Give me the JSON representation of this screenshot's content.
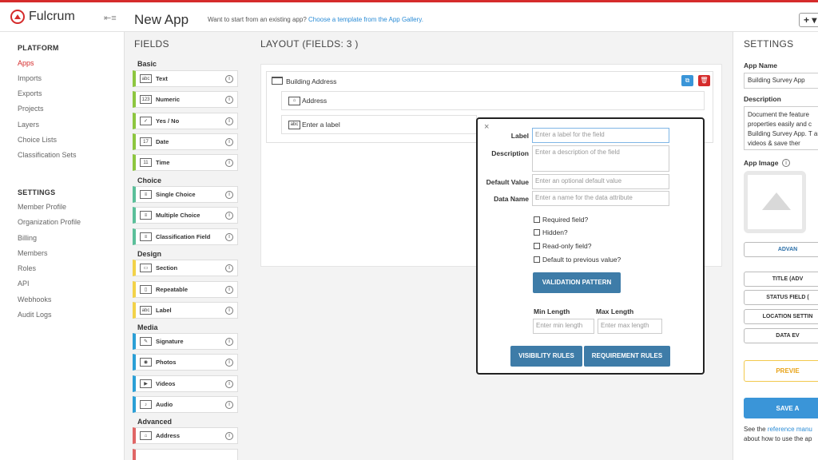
{
  "header": {
    "brand": "Fulcrum",
    "title": "New App",
    "gallery_prompt": "Want to start from an existing app?",
    "gallery_link": "Choose a template from the App Gallery.",
    "plus_label": "+ ▾"
  },
  "sidebar": {
    "platform_heading": "PLATFORM",
    "platform_items": [
      "Apps",
      "Imports",
      "Exports",
      "Projects",
      "Layers",
      "Choice Lists",
      "Classification Sets"
    ],
    "settings_heading": "SETTINGS",
    "settings_items": [
      "Member Profile",
      "Organization Profile",
      "Billing",
      "Members",
      "Roles",
      "API",
      "Webhooks",
      "Audit Logs"
    ]
  },
  "fields": {
    "title": "FIELDS",
    "categories": [
      "Basic",
      "Choice",
      "Design",
      "Media",
      "Advanced"
    ],
    "items": [
      {
        "label": "Text",
        "icon": "abc"
      },
      {
        "label": "Numeric",
        "icon": "123"
      },
      {
        "label": "Yes / No",
        "icon": "✓"
      },
      {
        "label": "Date",
        "icon": "17"
      },
      {
        "label": "Time",
        "icon": "11"
      },
      {
        "label": "Single Choice",
        "icon": "≡"
      },
      {
        "label": "Multiple Choice",
        "icon": "≡"
      },
      {
        "label": "Classification Field",
        "icon": "≡"
      },
      {
        "label": "Section",
        "icon": "▭"
      },
      {
        "label": "Repeatable",
        "icon": "▯"
      },
      {
        "label": "Label",
        "icon": "abc"
      },
      {
        "label": "Signature",
        "icon": "✎"
      },
      {
        "label": "Photos",
        "icon": "◉"
      },
      {
        "label": "Videos",
        "icon": "▶"
      },
      {
        "label": "Audio",
        "icon": "♪"
      },
      {
        "label": "Address",
        "icon": "⌂"
      }
    ],
    "colors": {
      "basic": "#8dc63f",
      "choice": "#5bbf9a",
      "design": "#f2d249",
      "media": "#2b9fd6",
      "advanced": "#e06666"
    }
  },
  "layout": {
    "title": "LAYOUT  (FIELDS: 3 )",
    "section_label": "Building Address",
    "sub_fields": [
      "Address",
      "Enter a label"
    ]
  },
  "popup": {
    "close": "×",
    "label_label": "Label",
    "label_placeholder": "Enter a label for the field",
    "description_label": "Description",
    "description_placeholder": "Enter a description of the field",
    "default_label": "Default Value",
    "default_placeholder": "Enter an optional default value",
    "dataname_label": "Data Name",
    "dataname_placeholder": "Enter a name for the data attribute",
    "checkboxes": [
      "Required field?",
      "Hidden?",
      "Read-only field?",
      "Default to previous value?"
    ],
    "validation_button": "VALIDATION PATTERN",
    "min_label": "Min Length",
    "max_label": "Max Length",
    "min_placeholder": "Enter min length",
    "max_placeholder": "Enter max length",
    "visibility_button": "VISIBILITY RULES",
    "requirement_button": "REQUIREMENT RULES"
  },
  "settings": {
    "title": "SETTINGS",
    "app_name_label": "App Name",
    "app_name_value": "Building Survey App",
    "description_label": "Description",
    "description_value": "Document the feature properties easily and c Building Survey App. T and videos & save ther",
    "image_label": "App Image",
    "advanced_button": "ADVAN",
    "buttons": [
      "TITLE (ADV",
      "STATUS FIELD (",
      "LOCATION SETTIN",
      "DATA EV"
    ],
    "preview_button": "PREVIE",
    "save_button": "SAVE A",
    "footer_prefix": "See the ",
    "footer_link": "reference manu",
    "footer_suffix": "about how to use the ap"
  }
}
